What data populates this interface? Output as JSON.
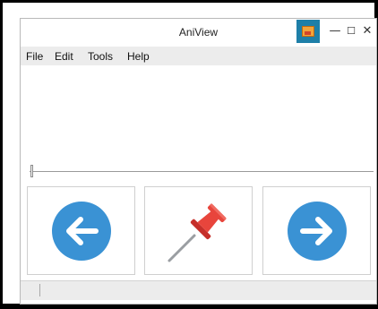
{
  "window": {
    "title": "AniView",
    "minimize_glyph": "—",
    "maximize_glyph": "☐",
    "close_glyph": "✕"
  },
  "menu": {
    "items": [
      {
        "label": "File"
      },
      {
        "label": "Edit"
      },
      {
        "label": "Tools"
      },
      {
        "label": "Help"
      }
    ]
  },
  "slider": {
    "value": 0
  },
  "tiles": {
    "prev_icon": "arrow-left-icon",
    "pin_icon": "pushpin-icon",
    "next_icon": "arrow-right-icon"
  },
  "colors": {
    "accent": "#1e7fa8",
    "arrow_circle": "#3a92d4",
    "pin_red": "#e8453c"
  },
  "status": {
    "text": ""
  }
}
